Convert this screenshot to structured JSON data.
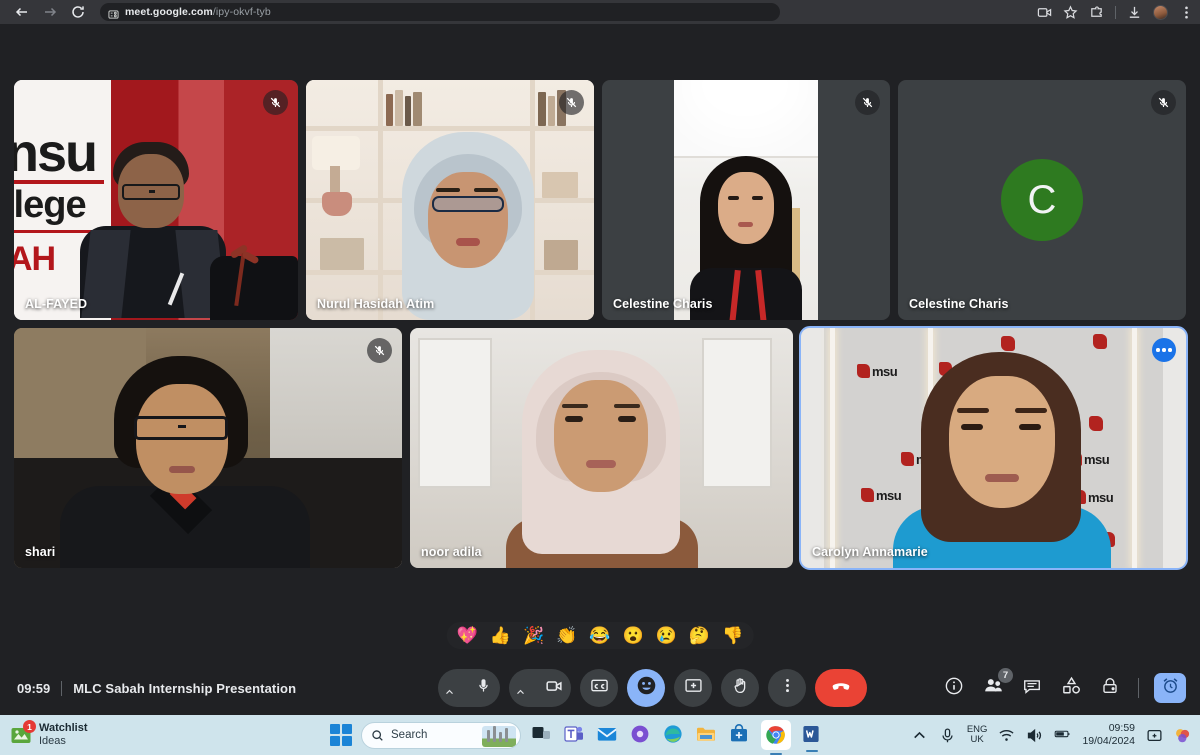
{
  "browser": {
    "url_domain": "meet.google.com",
    "url_path": "/ipy-okvf-tyb",
    "back_icon": "back-arrow-icon",
    "forward_icon": "forward-arrow-icon",
    "reload_icon": "reload-icon",
    "site_info_icon": "site-settings-icon",
    "media_icon": "media-cast-icon",
    "bookmark_icon": "star-icon",
    "extensions_icon": "extensions-puzzle-icon",
    "downloads_icon": "download-icon",
    "profile_icon": "profile-avatar-icon",
    "menu_icon": "three-dot-menu-icon"
  },
  "meeting": {
    "time": "09:59",
    "title": "MLC Sabah Internship Presentation",
    "participant_count": "7"
  },
  "tiles": [
    {
      "name": "AL-FAYED",
      "muted": true,
      "avatar": false,
      "speaking": false,
      "options": false
    },
    {
      "name": "Nurul Hasidah Atim",
      "muted": true,
      "avatar": false,
      "speaking": false,
      "options": false
    },
    {
      "name": "Celestine Charis",
      "muted": true,
      "avatar": false,
      "speaking": false,
      "options": false
    },
    {
      "name": "Celestine Charis",
      "muted": true,
      "avatar": true,
      "speaking": false,
      "options": false,
      "initial": "C",
      "avatar_color": "#2e7a20"
    },
    {
      "name": "shari",
      "muted": true,
      "avatar": false,
      "speaking": false,
      "options": false
    },
    {
      "name": "noor adila",
      "muted": false,
      "avatar": false,
      "speaking": false,
      "options": false
    },
    {
      "name": "Carolyn Annamarie",
      "muted": false,
      "avatar": false,
      "speaking": true,
      "options": true
    }
  ],
  "reactions": [
    {
      "name": "sparkling-heart",
      "glyph": "💖"
    },
    {
      "name": "thumbs-up",
      "glyph": "👍"
    },
    {
      "name": "party-popper",
      "glyph": "🎉"
    },
    {
      "name": "clapping-hands",
      "glyph": "👏"
    },
    {
      "name": "face-with-tears-of-joy",
      "glyph": "😂"
    },
    {
      "name": "face-with-open-mouth",
      "glyph": "😮"
    },
    {
      "name": "crying-face",
      "glyph": "😢"
    },
    {
      "name": "thinking-face",
      "glyph": "🤔"
    },
    {
      "name": "thumbs-down",
      "glyph": "👎"
    }
  ],
  "controls": {
    "mic": "microphone-button",
    "mic_chevron": "mic-options-chevron",
    "camera": "camera-button",
    "camera_chevron": "camera-options-chevron",
    "captions": "closed-captions-button",
    "emoji": "emoji-reactions-button",
    "present": "present-screen-button",
    "raise_hand": "raise-hand-button",
    "more": "more-options-button",
    "leave": "leave-call-button"
  },
  "panel_buttons": {
    "info": "meeting-details-button",
    "people": "people-button",
    "chat": "chat-button",
    "activities": "activities-button",
    "host_controls": "host-controls-button",
    "timer": "timer-button"
  },
  "taskbar": {
    "widget_title": "Watchlist",
    "widget_subtitle": "Ideas",
    "widget_badge": "1",
    "search_placeholder": "Search",
    "language_line1": "ENG",
    "language_line2": "UK",
    "clock_time": "09:59",
    "clock_date": "19/04/2024",
    "apps": [
      {
        "name": "start-button"
      },
      {
        "name": "task-view-button"
      },
      {
        "name": "microsoft-teams-app"
      },
      {
        "name": "mail-app"
      },
      {
        "name": "microsoft-365-app"
      },
      {
        "name": "microsoft-edge-app"
      },
      {
        "name": "file-explorer-app"
      },
      {
        "name": "microsoft-store-app"
      },
      {
        "name": "google-chrome-app"
      },
      {
        "name": "microsoft-word-app"
      }
    ]
  },
  "colors": {
    "accent_blue": "#8ab4f8",
    "end_call_red": "#ea4335",
    "meet_bg": "#202124",
    "tile_bg": "#3c4043",
    "taskbar_bg": "#cfe4ec"
  }
}
